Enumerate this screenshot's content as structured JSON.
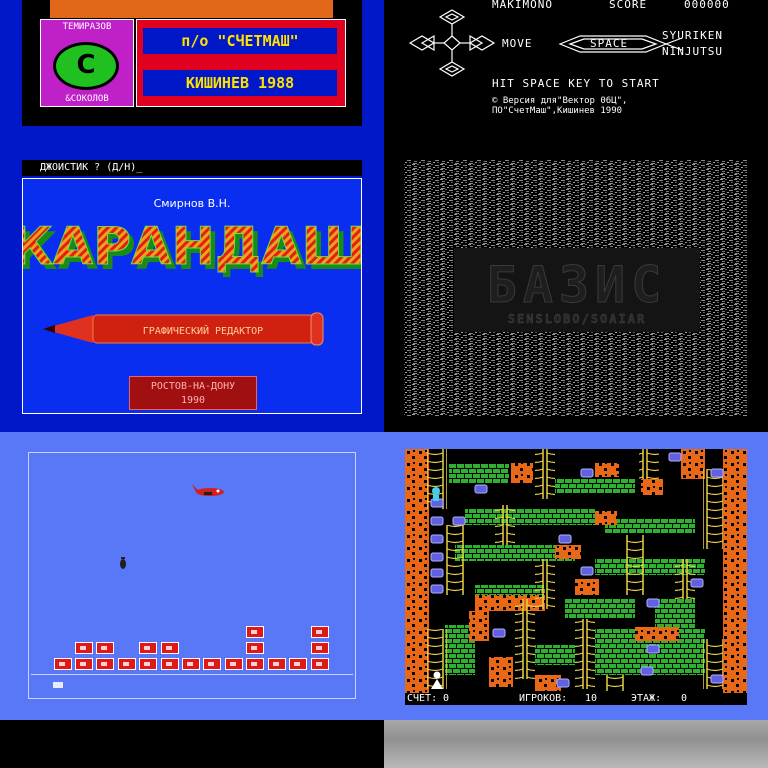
{
  "tiles": {
    "sm_1988": {
      "logo_top": "ТЕМИРАЗОВ",
      "logo_letter": "С",
      "logo_bottom": "&СОКОЛОВ",
      "plate_line1": "п/о \"СЧЕТМАШ\"",
      "plate_line2": "КИШИНЕВ 1988",
      "colors": {
        "bg": "#0018c8",
        "accent": "#e06818",
        "plate": "#e00020",
        "logo": "#c020c8",
        "text": "#ffe000"
      }
    },
    "makimono": {
      "title": "MAKIMONO",
      "score_label": "SCORE",
      "score_value": "000000",
      "move_label": "MOVE",
      "space_label": "SPACE",
      "syuriken_label": "SYURIKEN",
      "ninjutsu_label": "NINJUTSU",
      "start_prompt": "HIT SPACE KEY TO START",
      "credit_line1": "© Версия для\"Вектор 06Ц\",",
      "credit_line2": "ПО\"СчетМаш\",Кишинев  1990"
    },
    "karandash": {
      "prompt": "ДЖОИСТИК ? (Д/Н)_",
      "author": "Смирнов В.Н.",
      "title": "КАРАНДАШ",
      "subtitle": "ГРАФИЧЕСКИЙ  РЕДАКТОР",
      "city": "РОСТОВ-НА-ДОНУ",
      "year": "1990"
    },
    "bazis": {
      "title": "БАЗИС",
      "subtitle": "SENSLOBO/SOAIAR"
    },
    "bomber": {
      "colors": {
        "bg": "#5878f8",
        "brick": "#e01818"
      }
    },
    "lode": {
      "score_label": "СЧЕТ:",
      "score_value": "0",
      "players_label": "ИГРОКОВ:",
      "players_value": "10",
      "floor_label": "ЭТАЖ:",
      "floor_value": "0"
    }
  }
}
